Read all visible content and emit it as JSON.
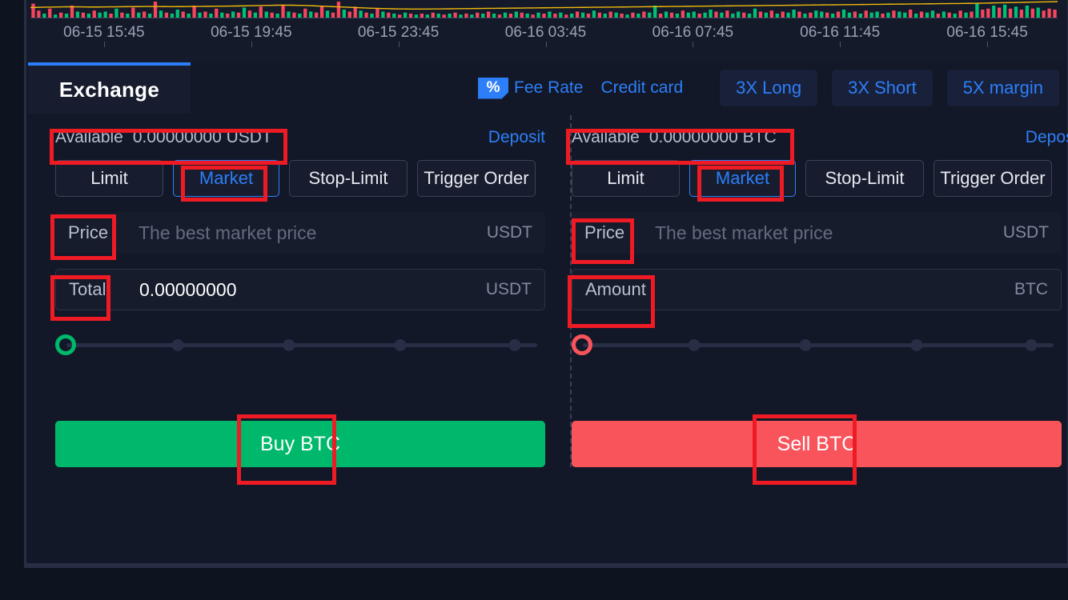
{
  "chart_data": {
    "type": "bar",
    "title": "",
    "xlabel": "",
    "ylabel": "",
    "grid": false,
    "legend_position": "none",
    "x_tick_labels": [
      "06-15 15:45",
      "06-15 19:45",
      "06-15 23:45",
      "06-16 03:45",
      "06-16 07:45",
      "06-16 11:45",
      "06-16 15:45"
    ],
    "series": [
      {
        "name": "Volume",
        "type": "bar",
        "up_color": "#00c076",
        "down_color": "#f6465d",
        "values": [
          14,
          7,
          4,
          9,
          3,
          5,
          4,
          12,
          6,
          5,
          4,
          7,
          5,
          6,
          4,
          9,
          5,
          4,
          10,
          5,
          6,
          4,
          16,
          7,
          5,
          4,
          8,
          6,
          4,
          12,
          5,
          6,
          4,
          9,
          5,
          4,
          6,
          5,
          10,
          7,
          5,
          11,
          6,
          5,
          4,
          13,
          6,
          5,
          4,
          9,
          6,
          5,
          12,
          7,
          5,
          16,
          8,
          6,
          11,
          7,
          5,
          4,
          9,
          6,
          5,
          4,
          3,
          5,
          4,
          3,
          4,
          3,
          5,
          4,
          3,
          4,
          5,
          3,
          4,
          3,
          5,
          4,
          6,
          4,
          3,
          5,
          4,
          6,
          5,
          4,
          3,
          5,
          4,
          6,
          4,
          5,
          3,
          4,
          6,
          5,
          4,
          7,
          5,
          4,
          6,
          5,
          4,
          3,
          5,
          4,
          6,
          5,
          12,
          4,
          6,
          5,
          4,
          7,
          5,
          6,
          4,
          5,
          8,
          6,
          5,
          7,
          4,
          6,
          5,
          4,
          9,
          6,
          5,
          7,
          4,
          6,
          5,
          8,
          6,
          4,
          5,
          7,
          6,
          5,
          4,
          6,
          8,
          5,
          6,
          4,
          7,
          5,
          6,
          4,
          5,
          7,
          6,
          5,
          8,
          4,
          6,
          5,
          7,
          4,
          6,
          5,
          4,
          7,
          5,
          6,
          14,
          8,
          9,
          12,
          10,
          13,
          9,
          11,
          8,
          12,
          9,
          10,
          7,
          9,
          8
        ],
        "directions": [
          "down",
          "down",
          "up",
          "down",
          "up",
          "down",
          "up",
          "down",
          "up",
          "down",
          "up",
          "down",
          "up",
          "up",
          "down",
          "up",
          "down",
          "up",
          "down",
          "up",
          "down",
          "up",
          "down",
          "up",
          "down",
          "up",
          "up",
          "down",
          "up",
          "down",
          "up",
          "down",
          "up",
          "down",
          "up",
          "down",
          "up",
          "down",
          "up",
          "down",
          "up",
          "down",
          "up",
          "down",
          "up",
          "down",
          "up",
          "down",
          "up",
          "down",
          "up",
          "down",
          "down",
          "up",
          "down",
          "down",
          "up",
          "down",
          "down",
          "up",
          "down",
          "up",
          "down",
          "up",
          "down",
          "up",
          "down",
          "up",
          "down",
          "up",
          "down",
          "up",
          "down",
          "up",
          "down",
          "up",
          "down",
          "up",
          "down",
          "up",
          "down",
          "up",
          "down",
          "up",
          "down",
          "up",
          "down",
          "up",
          "down",
          "up",
          "down",
          "up",
          "down",
          "up",
          "down",
          "up",
          "down",
          "up",
          "down",
          "up",
          "down",
          "up",
          "down",
          "up",
          "down",
          "up",
          "down",
          "up",
          "down",
          "up",
          "down",
          "up",
          "up",
          "down",
          "up",
          "down",
          "up",
          "down",
          "up",
          "up",
          "down",
          "up",
          "up",
          "down",
          "up",
          "down",
          "up",
          "up",
          "down",
          "up",
          "up",
          "down",
          "up",
          "down",
          "up",
          "down",
          "up",
          "up",
          "down",
          "up",
          "down",
          "up",
          "up",
          "down",
          "up",
          "down",
          "up",
          "up",
          "down",
          "up",
          "down",
          "up",
          "up",
          "down",
          "up",
          "down",
          "up",
          "up",
          "down",
          "up",
          "down",
          "up",
          "up",
          "down",
          "up",
          "down",
          "up",
          "down",
          "up",
          "down",
          "up",
          "down",
          "down",
          "up",
          "down",
          "up",
          "down",
          "up",
          "down",
          "up",
          "down",
          "up",
          "down"
        ]
      },
      {
        "name": "MA",
        "type": "line",
        "color": "#f0b90b",
        "values": [
          16,
          16.2,
          16.4,
          16.6,
          16.8,
          17,
          17.2,
          17.3,
          17.2,
          17.1,
          17,
          16.9,
          16.9,
          17,
          17.1,
          17.2,
          17.3,
          17.4,
          17.5,
          17.6,
          17.7,
          17.8,
          17.8,
          17.7,
          17.6,
          17.5,
          17.5,
          17.6,
          17.7,
          17.8,
          17.9,
          18,
          18.1,
          18.2,
          18.3,
          18.4,
          18.5,
          18.6,
          18.8,
          19,
          19.2,
          19.4,
          19.6,
          19.8,
          20,
          20.1,
          20.1,
          20,
          19.8,
          19.5,
          19.2,
          18.8,
          18.4,
          18,
          17.6,
          17.2,
          16.8,
          16.4,
          16,
          15.6,
          15.2,
          14.8,
          14.5,
          14.2,
          14,
          13.8,
          13.6,
          13.5,
          13.4,
          13.3,
          13.3,
          13.4,
          13.5,
          13.6,
          13.7,
          13.8,
          13.9,
          14,
          14.1,
          14.2,
          14.3,
          14.4,
          14.5,
          14.6,
          14.7,
          14.8,
          14.9,
          15,
          15.1,
          15.2,
          15.3,
          15.4,
          15.5,
          15.6,
          15.7,
          15.8,
          15.9,
          16,
          16.1,
          16.2,
          16.3,
          16.4,
          16.5,
          16.6,
          16.7,
          16.8,
          16.9,
          17,
          17.1,
          17.2,
          17.3,
          17.4,
          17.5,
          17.6,
          17.7,
          17.8,
          17.9,
          18,
          18.1,
          18.2,
          18.3,
          18.4,
          18.5,
          18.6,
          18.7,
          18.8,
          18.9,
          19,
          19.1,
          19.2,
          19.3,
          19.4,
          19.5,
          19.6,
          19.7,
          19.8,
          19.9,
          20,
          20.1,
          20.2,
          20.3,
          20.4,
          20.5,
          20.6,
          20.7,
          20.8,
          20.9,
          21,
          21.1,
          21.2,
          21.3,
          21.4,
          21.5,
          21.6,
          21.7,
          21.8,
          21.9,
          22,
          22.1,
          22.2,
          22.3,
          22.4,
          22.5,
          22.6,
          22.7,
          22.8,
          22.9,
          23,
          23.1,
          23.2,
          23.4,
          23.6,
          23.8,
          24,
          24.2,
          24.4,
          24.6,
          24.8,
          25,
          25.2,
          25.4,
          25.6,
          25.8,
          26,
          26.2
        ]
      }
    ]
  },
  "panel": {
    "tab_label": "Exchange",
    "fee_rate_icon": "percent-badge-icon",
    "fee_rate_label": "Fee Rate",
    "credit_card_label": "Credit card",
    "leverage_buttons": [
      {
        "label": "3X Long"
      },
      {
        "label": "3X Short"
      },
      {
        "label": "5X margin"
      }
    ]
  },
  "buy": {
    "available_label": "Available",
    "available_value": "0.00000000 USDT",
    "deposit_label": "Deposit",
    "order_types": [
      {
        "label": "Limit",
        "active": false
      },
      {
        "label": "Market",
        "active": true
      },
      {
        "label": "Stop-Limit",
        "active": false
      },
      {
        "label": "Trigger Order",
        "active": false
      }
    ],
    "price_label": "Price",
    "price_value": "",
    "price_placeholder": "The best market price",
    "price_unit": "USDT",
    "total_label": "Total",
    "total_value": "0.00000000",
    "total_placeholder": "",
    "total_unit": "USDT",
    "slider_percent": 0,
    "action_label": "Buy BTC"
  },
  "sell": {
    "available_label": "Available",
    "available_value": "0.00000000 BTC",
    "deposit_label": "Deposit",
    "order_types": [
      {
        "label": "Limit",
        "active": false
      },
      {
        "label": "Market",
        "active": true
      },
      {
        "label": "Stop-Limit",
        "active": false
      },
      {
        "label": "Trigger Order",
        "active": false
      }
    ],
    "price_label": "Price",
    "price_value": "",
    "price_placeholder": "The best market price",
    "price_unit": "USDT",
    "amount_label": "Amount",
    "amount_value": "",
    "amount_placeholder": "",
    "amount_unit": "BTC",
    "slider_percent": 0,
    "action_label": "Sell BTC"
  },
  "colors": {
    "accent_blue": "#2d7ff9",
    "buy_green": "#00b86b",
    "sell_red": "#f9545b",
    "annotation_red": "#ee1b24",
    "panel_bg": "#121827",
    "page_bg": "#0e1320"
  }
}
